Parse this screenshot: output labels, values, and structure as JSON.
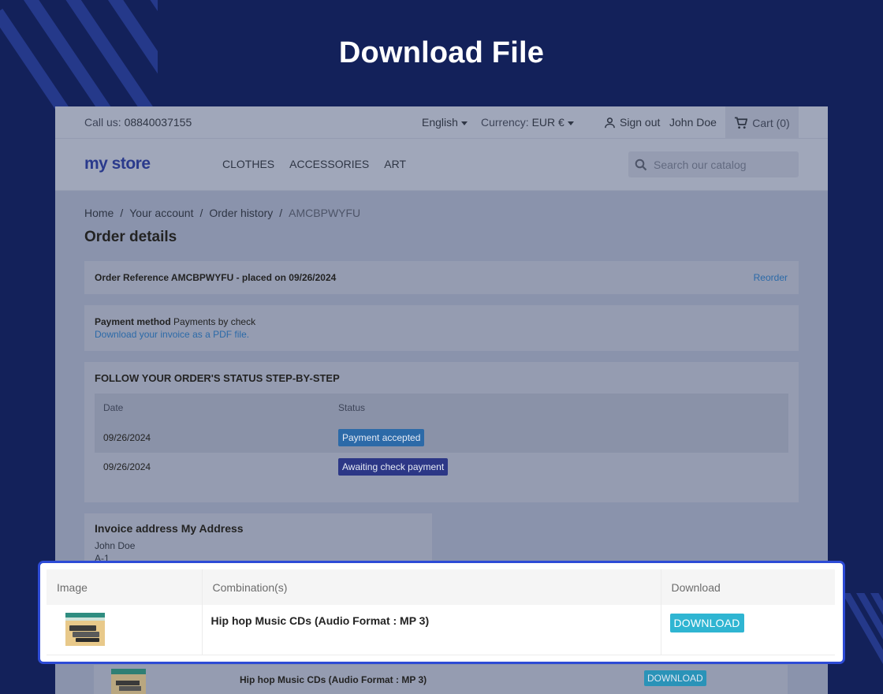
{
  "hero_title": "Download File",
  "topbar": {
    "call_label": "Call us:",
    "phone": "08840037155",
    "language": "English",
    "currency_label": "Currency:",
    "currency_value": "EUR €",
    "sign_out": "Sign out",
    "user_name": "John Doe",
    "cart": "Cart (0)"
  },
  "header": {
    "logo_text": "my store",
    "nav": [
      "CLOTHES",
      "ACCESSORIES",
      "ART"
    ],
    "search_placeholder": "Search our catalog"
  },
  "breadcrumb": [
    "Home",
    "Your account",
    "Order history",
    "AMCBPWYFU"
  ],
  "page_title": "Order details",
  "order_ref": {
    "text": "Order Reference AMCBPWYFU - placed on 09/26/2024",
    "reorder": "Reorder"
  },
  "payment": {
    "label": "Payment method",
    "value": "Payments by check",
    "invoice_link": "Download your invoice as a PDF file."
  },
  "status": {
    "heading": "FOLLOW YOUR ORDER'S STATUS STEP-BY-STEP",
    "columns": [
      "Date",
      "Status"
    ],
    "rows": [
      {
        "date": "09/26/2024",
        "status": "Payment accepted"
      },
      {
        "date": "09/26/2024",
        "status": "Awaiting check payment"
      }
    ]
  },
  "invoice_address": {
    "heading": "Invoice address My Address",
    "line1": "John Doe",
    "line2": "A-1"
  },
  "downloads": {
    "columns": [
      "Image",
      "Combination(s)",
      "Download"
    ],
    "rows": [
      {
        "combination": "Hip hop Music CDs (Audio Format : MP 3)",
        "button": "DOWNLOAD"
      }
    ]
  },
  "faded_row": {
    "combination": "Hip hop Music CDs (Audio Format : MP 3)",
    "button": "DOWNLOAD"
  },
  "colors": {
    "background": "#13215a",
    "highlight_border": "#2d4bd6",
    "download_button": "#2fb5d2"
  }
}
